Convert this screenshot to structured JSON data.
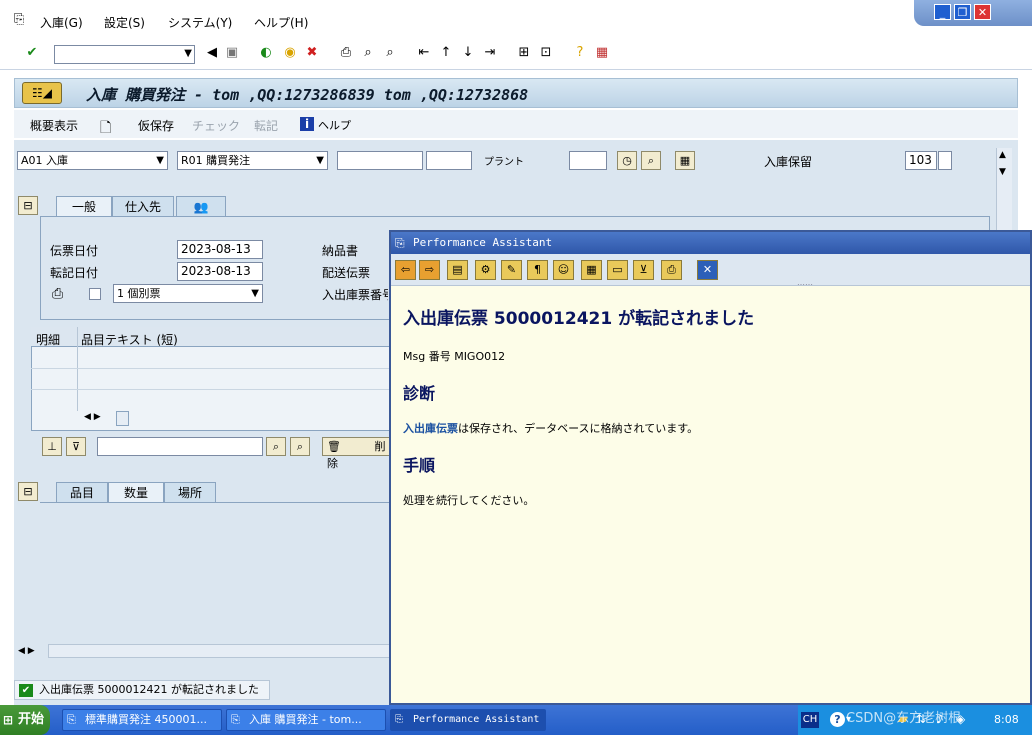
{
  "menu": {
    "items": [
      "入庫(G)",
      "設定(S)",
      "システム(Y)",
      "ヘルプ(H)"
    ]
  },
  "title": "入庫 購買発注 - tom ,QQ:1273286839 tom ,QQ:12732868",
  "app_toolbar": {
    "summary": "概要表示",
    "save_draft": "仮保存",
    "check": "チェック",
    "post": "転記",
    "help": "ヘルプ"
  },
  "header": {
    "action": "A01 入庫",
    "ref_doc": "R01 購買発注",
    "plant_label": "プラント",
    "stock_label": "入庫保留",
    "movement_type": "103"
  },
  "header_tabs": [
    "一般",
    "仕入先"
  ],
  "general": {
    "doc_date_label": "伝票日付",
    "doc_date": "2023-08-13",
    "post_date_label": "転記日付",
    "post_date": "2023-08-13",
    "print_option": "1 個別票",
    "delivery_note_label": "納品書",
    "bill_of_lading_label": "配送伝票",
    "gr_slip_label": "入出庫票番号"
  },
  "items_table": {
    "col_line": "明細",
    "col_text": "品目テキスト (短)"
  },
  "delete_label": "削除",
  "detail_tabs": [
    "品目",
    "数量",
    "場所"
  ],
  "status_message": "入出庫伝票 5000012421 が転記されました",
  "performance_assistant": {
    "window_title": "Performance Assistant",
    "heading": "入出庫伝票  5000012421 が転記されました",
    "msg_number": "Msg 番号  MIGO012",
    "diagnosis_title": "診断",
    "diagnosis_link": "入出庫伝票",
    "diagnosis_text": "は保存され、データベースに格納されています。",
    "procedure_title": "手順",
    "procedure_text": "処理を続行してください。"
  },
  "taskbar": {
    "start": "开始",
    "items": [
      "標準購買発注 450001...",
      "入庫 購買発注 - tom...",
      "Performance Assistant"
    ],
    "lang": "CH",
    "clock": "8:08",
    "watermark": "CSDN@东方老树根"
  },
  "colors": {
    "title_band": "#bcd3e6",
    "pa_title": "#2f57a9",
    "pa_heading": "#0a1560",
    "link": "#1a50a0",
    "taskbar": "#245ec8"
  }
}
